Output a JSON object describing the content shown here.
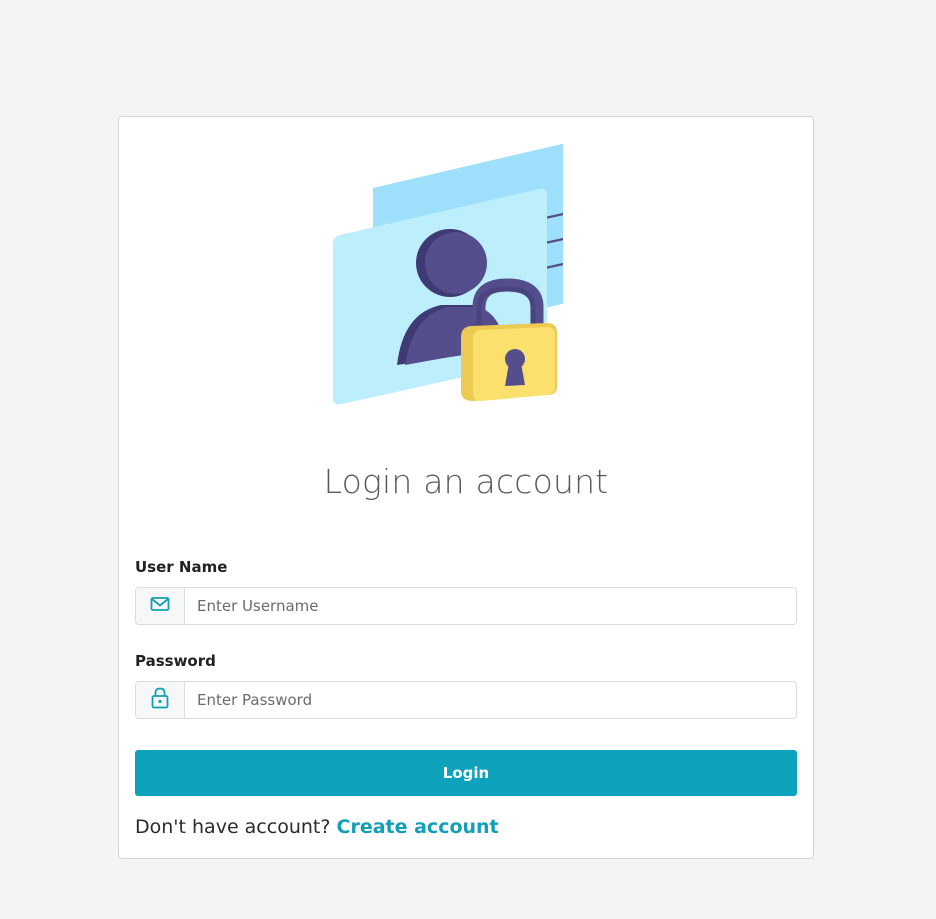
{
  "page": {
    "title": "Login an account"
  },
  "form": {
    "username": {
      "label": "User Name",
      "placeholder": "Enter Username",
      "value": "",
      "icon": "envelope-icon"
    },
    "password": {
      "label": "Password",
      "placeholder": "Enter Password",
      "value": "",
      "icon": "lock-icon"
    },
    "login_label": "Login"
  },
  "signup": {
    "prompt": "Don't have account?",
    "link_label": "Create account"
  },
  "colors": {
    "background": "#f4f4f4",
    "accent": "#0fa2bd",
    "link": "#139fb7",
    "card": "#ffffff",
    "illustration_card_back": "#9ee0fb",
    "illustration_card_front": "#bdeefc",
    "person": "#544e8c",
    "padlock": "#f9df6b"
  }
}
